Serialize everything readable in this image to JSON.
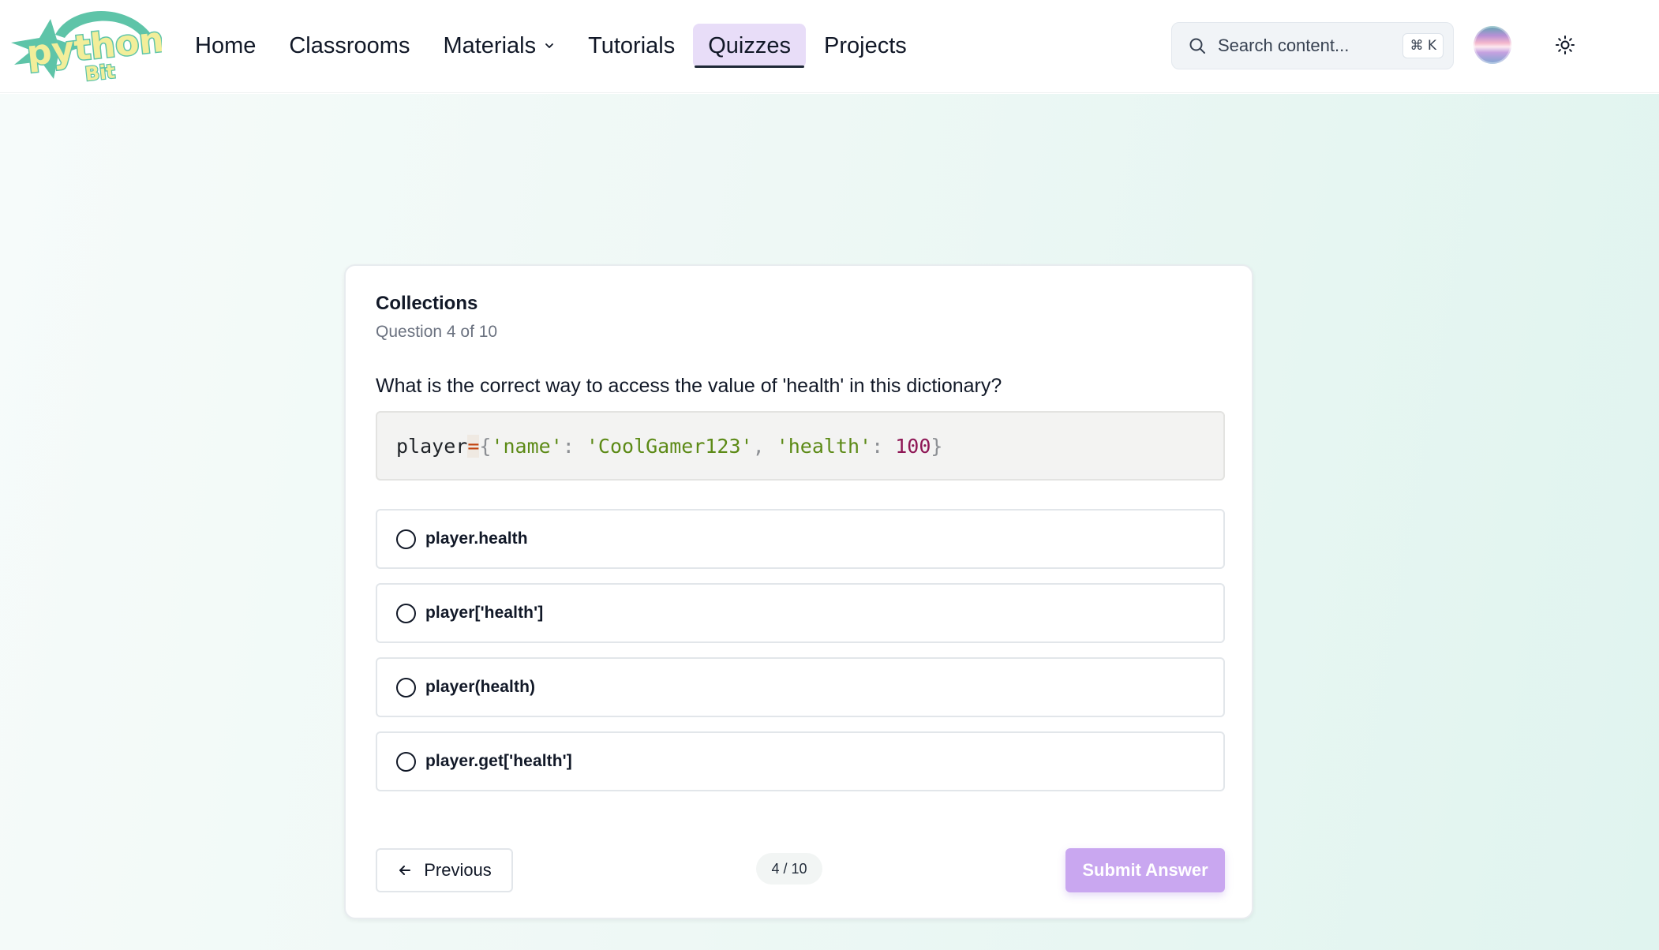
{
  "header": {
    "logo": {
      "text_main": "python",
      "text_sub": "Bit",
      "icon": "python-bit-logo"
    },
    "nav": [
      {
        "label": "Home",
        "active": false
      },
      {
        "label": "Classrooms",
        "active": false
      },
      {
        "label": "Materials",
        "active": false,
        "has_dropdown": true
      },
      {
        "label": "Tutorials",
        "active": false
      },
      {
        "label": "Quizzes",
        "active": true
      },
      {
        "label": "Projects",
        "active": false
      }
    ],
    "search": {
      "placeholder": "Search content...",
      "shortcut": "⌘ K",
      "icon": "search-icon"
    },
    "avatar": {
      "icon": "user-avatar"
    },
    "theme_toggle": {
      "icon": "sun-icon"
    }
  },
  "quiz": {
    "topic": "Collections",
    "progress_text": "Question 4 of 10",
    "question": "What is the correct way to access the value of 'health' in this dictionary?",
    "code": {
      "var": "player",
      "op": "=",
      "open": "{",
      "key1": "'name'",
      "colon1": ": ",
      "val1": "'CoolGamer123'",
      "comma": ", ",
      "key2": "'health'",
      "colon2": ": ",
      "val2": "100",
      "close": "}"
    },
    "options": [
      {
        "label": "player.health",
        "selected": false
      },
      {
        "label": "player['health']",
        "selected": false
      },
      {
        "label": "player(health)",
        "selected": false
      },
      {
        "label": "player.get['health']",
        "selected": false
      }
    ],
    "previous_label": "Previous",
    "counter": "4 / 10",
    "current_question": 4,
    "total_questions": 10,
    "submit_label": "Submit Answer"
  },
  "colors": {
    "accent": "#c9a7f0",
    "active_tab_bg": "#e8ddf8",
    "logo_teal": "#5ec4a8",
    "logo_yellow": "#f2ee9a"
  }
}
